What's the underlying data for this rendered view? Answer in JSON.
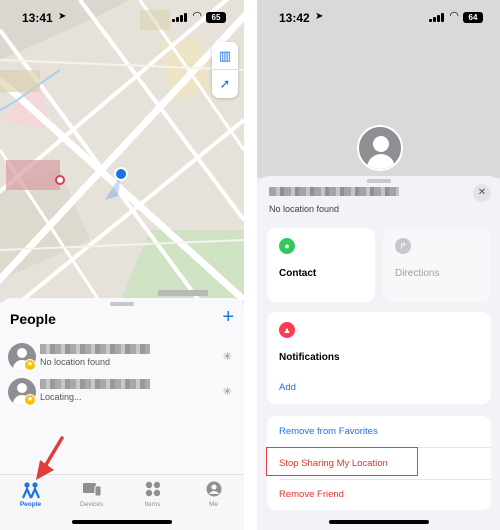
{
  "left": {
    "status": {
      "time": "13:41",
      "battery": "65"
    },
    "map": {
      "user_dot_color": "#1a73e8"
    },
    "sheet": {
      "title": "People",
      "add_symbol": "+",
      "people": [
        {
          "subtitle": "No location found"
        },
        {
          "subtitle": "Locating..."
        }
      ]
    },
    "tabs": [
      {
        "label": "People",
        "icon": "people-icon",
        "active": true
      },
      {
        "label": "Devices",
        "icon": "devices-icon",
        "active": false
      },
      {
        "label": "Items",
        "icon": "items-icon",
        "active": false
      },
      {
        "label": "Me",
        "icon": "me-icon",
        "active": false
      }
    ]
  },
  "right": {
    "status": {
      "time": "13:42",
      "battery": "64"
    },
    "detail": {
      "subtitle": "No location found",
      "close_symbol": "✕",
      "contact_label": "Contact",
      "directions_label": "Directions",
      "notifications_label": "Notifications",
      "add_label": "Add",
      "remove_favorites_label": "Remove from Favorites",
      "stop_sharing_label": "Stop Sharing My Location",
      "remove_friend_label": "Remove Friend"
    }
  },
  "colors": {
    "accent": "#1a73e8",
    "destructive": "#e0342c",
    "highlight": "#e34040",
    "favorite": "#f4c20d"
  }
}
